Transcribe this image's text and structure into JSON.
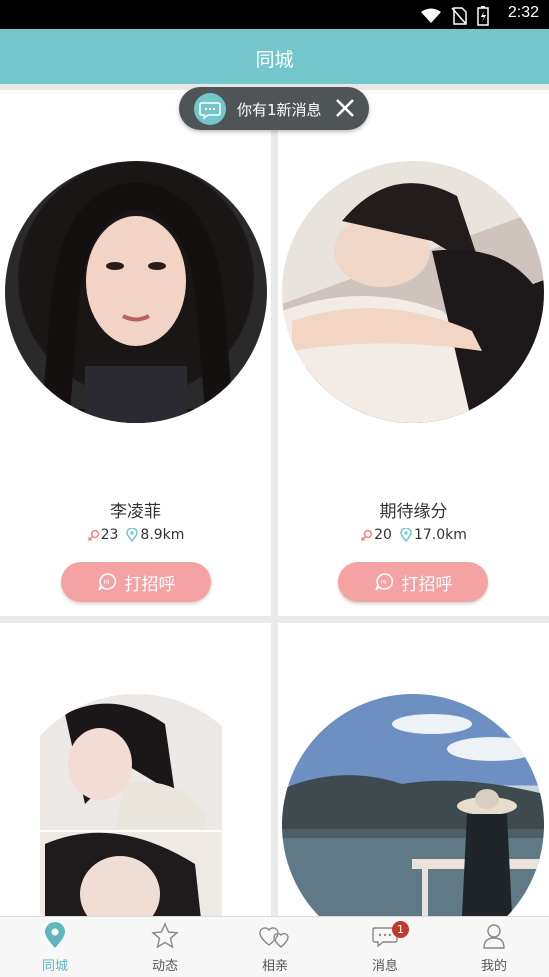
{
  "status": {
    "time": "2:32"
  },
  "header": {
    "title": "同城"
  },
  "toast": {
    "text": "你有1新消息"
  },
  "cards": [
    {
      "name": "李凌菲",
      "age": "23",
      "distance": "8.9km",
      "greet": "打招呼"
    },
    {
      "name": "期待缘分",
      "age": "20",
      "distance": "17.0km",
      "greet": "打招呼"
    }
  ],
  "tabs": [
    {
      "label": "同城"
    },
    {
      "label": "动态"
    },
    {
      "label": "相亲"
    },
    {
      "label": "消息",
      "badge": "1"
    },
    {
      "label": "我的"
    }
  ],
  "colors": {
    "accent": "#72c6cc",
    "greet": "#f4a2a2",
    "badge": "#c0392b"
  }
}
